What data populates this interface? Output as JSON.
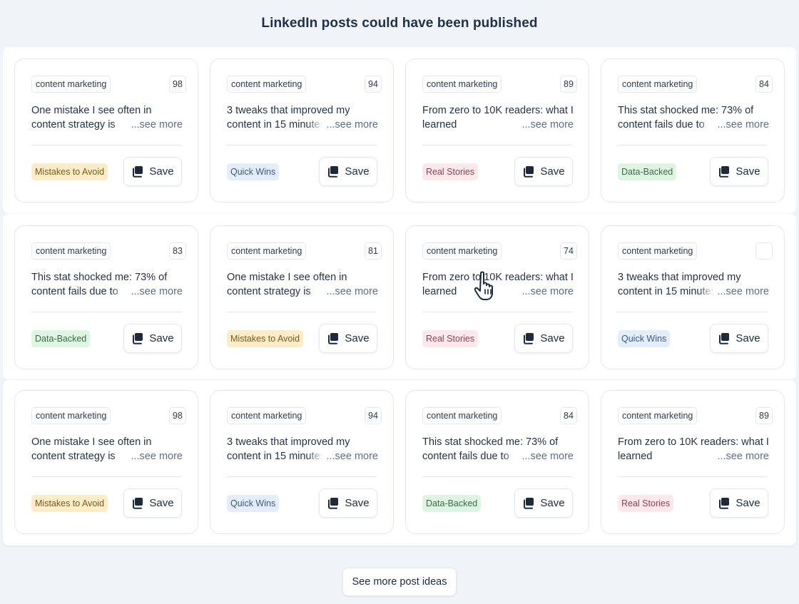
{
  "page": {
    "title": "LinkedIn posts could have been published",
    "more_button": "See more post ideas"
  },
  "card_ui": {
    "see_more_label": "...see more",
    "save_label": "Save",
    "save_icon": "copy-icon"
  },
  "colors": {
    "Mistakes to Avoid": {
      "bg": "#fdecc8",
      "fg": "#7a5a1c"
    },
    "Quick Wins": {
      "bg": "#e3edfb",
      "fg": "#3d5a80"
    },
    "Real Stories": {
      "bg": "#fde9ec",
      "fg": "#8a4452"
    },
    "Data-Backed": {
      "bg": "#dff5e3",
      "fg": "#3a6b45"
    }
  },
  "rows": [
    {
      "cards": [
        {
          "tag": "content marketing",
          "score": "98",
          "text": "One mistake I see often in content strategy is",
          "category": "Mistakes to Avoid"
        },
        {
          "tag": "content marketing",
          "score": "94",
          "text": "3 tweaks that improved my content in 15 minutes",
          "category": "Quick Wins"
        },
        {
          "tag": "content marketing",
          "score": "89",
          "text": "From zero to 10K readers: what I learned",
          "category": "Real Stories"
        },
        {
          "tag": "content marketing",
          "score": "84",
          "text": "This stat shocked me: 73% of content fails due to",
          "category": "Data-Backed"
        }
      ]
    },
    {
      "cards": [
        {
          "tag": "content marketing",
          "score": "83",
          "text": "This stat shocked me: 73% of content fails due to",
          "category": "Data-Backed"
        },
        {
          "tag": "content marketing",
          "score": "81",
          "text": "One mistake I see often in content strategy is",
          "category": "Mistakes to Avoid"
        },
        {
          "tag": "content marketing",
          "score": "74",
          "text": "From zero to 10K readers: what I learned",
          "category": "Real Stories"
        },
        {
          "tag": "content marketing",
          "score": "",
          "text": "3 tweaks that improved my content in 15 minutes",
          "category": "Quick Wins"
        }
      ]
    },
    {
      "cards": [
        {
          "tag": "content marketing",
          "score": "98",
          "text": "One mistake I see often in content strategy is",
          "category": "Mistakes to Avoid"
        },
        {
          "tag": "content marketing",
          "score": "94",
          "text": "3 tweaks that improved my content in 15 minutes",
          "category": "Quick Wins"
        },
        {
          "tag": "content marketing",
          "score": "84",
          "text": "This stat shocked me: 73% of content fails due to",
          "category": "Data-Backed"
        },
        {
          "tag": "content marketing",
          "score": "89",
          "text": "From zero to 10K readers: what I learned",
          "category": "Real Stories"
        }
      ]
    }
  ]
}
